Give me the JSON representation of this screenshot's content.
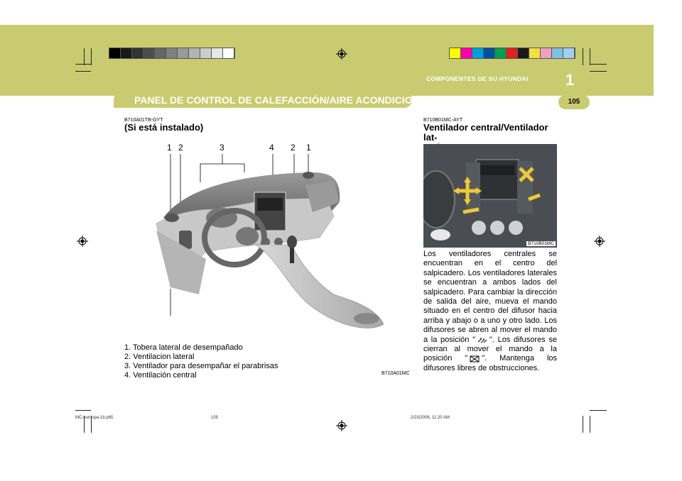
{
  "header": {
    "title": "PANEL DE CONTROL DE CALEFACCIÓN/AIRE ACONDICIONADO",
    "section": "COMPONENTES DE SU HYUNDAI",
    "chapter": "1",
    "page": "105"
  },
  "left": {
    "code": "B710A01TB-GYT",
    "heading": "(Si está instalado)",
    "callouts": [
      "1",
      "2",
      "3",
      "4",
      "2",
      "1"
    ],
    "image_code": "B710A01MC",
    "list": [
      "1. Tobera lateral de desempañado",
      "2. Ventilacion lateral",
      "3. Ventilador para desempañar el parabrisas",
      "4. Ventilación central"
    ]
  },
  "right": {
    "code": "B710B01MC-AYT",
    "heading_line1": "Ventilador central/Ventilador lat-",
    "heading_line2": "eral",
    "image_code": "B710B01MC",
    "para_a": "Los ventiladores centrales se encuentran en el centro del salpicadero. Los ventiladores laterales se encuentran a ambos lados del salpicadero.  Para cambiar la dirección de salida del aire, mueva el mando situado en el centro del difusor hacia arriba y abajo o a uno y otro lado. Los difusores se abren al mover el mando a la posición \"",
    "para_b": "\". Los difusores se cierran al mover el mando a la posición \"",
    "para_c": "\". Mantenga los difusores libres de obstrucciones."
  },
  "footer": {
    "file": "MC-eurospa-1b.p65",
    "page": "105",
    "date": "2/23/2006, 11:20 AM"
  },
  "colors": {
    "band": "#c9cb70",
    "grays": [
      "#000000",
      "#1a1a1a",
      "#333333",
      "#4d4d4d",
      "#666666",
      "#808080",
      "#999999",
      "#b3b3b3",
      "#cccccc",
      "#e6e6e6",
      "#ffffff"
    ],
    "process": [
      "#ffff00",
      "#ff00aa",
      "#00a0e0",
      "#0050a0",
      "#00a050",
      "#e02020",
      "#1a1a1a",
      "#f0e040",
      "#f0a0c0",
      "#80c0e0",
      "#a0d0f0"
    ]
  }
}
